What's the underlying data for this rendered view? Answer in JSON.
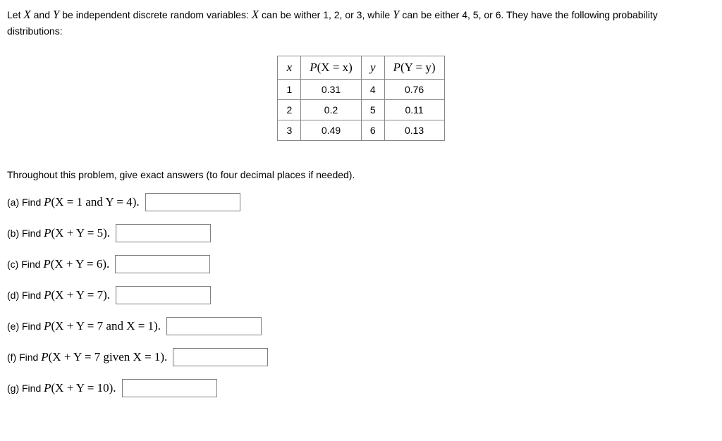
{
  "intro": {
    "part1": "Let ",
    "X": "X",
    "part2": " and ",
    "Y": "Y",
    "part3": " be independent discrete random variables: ",
    "X2": "X",
    "part4": " can be wither 1, 2, or 3, while ",
    "Y2": "Y",
    "part5": " can be either 4, 5, or 6. They have the following probability distributions:"
  },
  "table": {
    "header": {
      "x": "x",
      "px_pre": "P",
      "px_mid": "(X = x)",
      "y": "y",
      "py_pre": "P",
      "py_mid": "(Y = y)"
    },
    "rows": [
      {
        "x": "1",
        "px": "0.31",
        "y": "4",
        "py": "0.76"
      },
      {
        "x": "2",
        "px": "0.2",
        "y": "5",
        "py": "0.11"
      },
      {
        "x": "3",
        "px": "0.49",
        "y": "6",
        "py": "0.13"
      }
    ]
  },
  "instruction": "Throughout this problem, give exact answers (to four decimal places if needed).",
  "questions": {
    "a": {
      "label_pre": "(a) Find ",
      "math_p": "P",
      "math_body": "(X = 1 and Y = 4).",
      "placeholder": ""
    },
    "b": {
      "label_pre": "(b) Find ",
      "math_p": "P",
      "math_body": "(X + Y = 5).",
      "placeholder": ""
    },
    "c": {
      "label_pre": "(c) Find ",
      "math_p": "P",
      "math_body": "(X + Y = 6).",
      "placeholder": ""
    },
    "d": {
      "label_pre": "(d) Find ",
      "math_p": "P",
      "math_body": "(X + Y = 7).",
      "placeholder": ""
    },
    "e": {
      "label_pre": "(e) Find ",
      "math_p": "P",
      "math_body": "(X + Y = 7 and X = 1).",
      "placeholder": ""
    },
    "f": {
      "label_pre": "(f) Find ",
      "math_p": "P",
      "math_body": "(X + Y = 7 given X = 1).",
      "placeholder": ""
    },
    "g": {
      "label_pre": "(g) Find ",
      "math_p": "P",
      "math_body": "(X + Y = 10).",
      "placeholder": ""
    }
  }
}
